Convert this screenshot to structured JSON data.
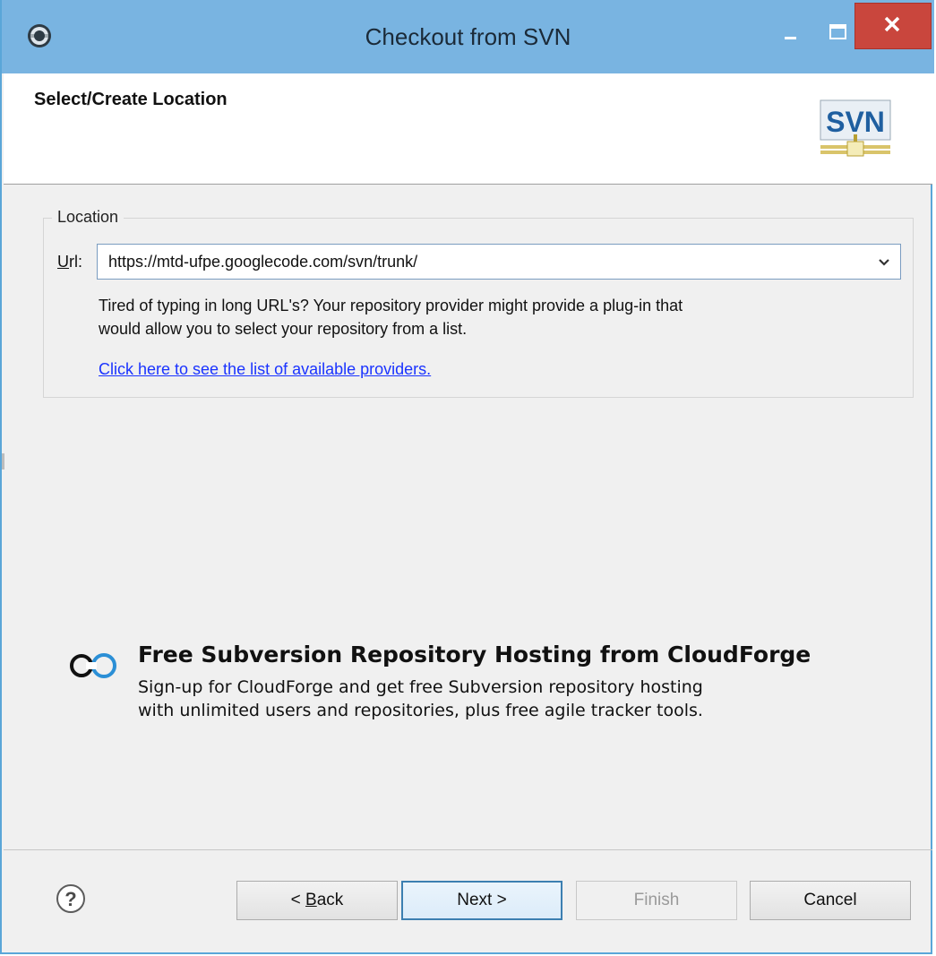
{
  "window": {
    "title": "Checkout from SVN"
  },
  "header": {
    "title": "Select/Create Location",
    "logo_text": "SVN"
  },
  "location": {
    "group_label": "Location",
    "url_label_prefix": "U",
    "url_label_rest": "rl:",
    "url_value": "https://mtd-ufpe.googlecode.com/svn/trunk/",
    "hint_line1": "Tired of typing in long URL's?  Your repository provider might provide a plug-in that",
    "hint_line2": "would allow you to select your repository from a list.",
    "providers_link": "Click here to see the list of available providers."
  },
  "cloudforge": {
    "title": "Free Subversion Repository Hosting from CloudForge",
    "line1": "Sign-up for CloudForge and get free Subversion repository hosting",
    "line2": "with unlimited users and repositories, plus free agile tracker tools."
  },
  "buttons": {
    "back_prefix": "< ",
    "back_mnemonic": "B",
    "back_rest": "ack",
    "next": "Next >",
    "finish": "Finish",
    "cancel": "Cancel"
  },
  "colors": {
    "titlebar": "#79b4e1",
    "close": "#c9463d",
    "link": "#1a33ff",
    "focus_border": "#3c7fb1"
  }
}
